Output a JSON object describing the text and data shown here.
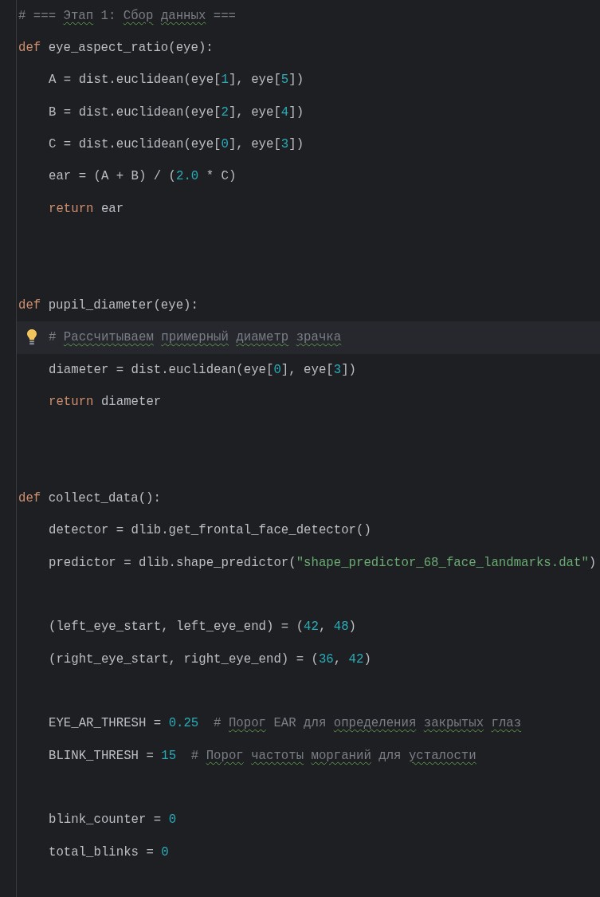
{
  "editor": {
    "lines": [
      {
        "kind": "code",
        "indented": false,
        "highlighted": false,
        "bulb": false,
        "tokens": [
          {
            "kind": "com",
            "text": "# === "
          },
          {
            "kind": "typo",
            "text": "Этап"
          },
          {
            "kind": "com",
            "text": " 1: "
          },
          {
            "kind": "typo",
            "text": "Сбор"
          },
          {
            "kind": "typo",
            "text": " данных"
          },
          {
            "kind": "com",
            "text": " ==="
          }
        ]
      },
      {
        "kind": "code",
        "indented": false,
        "highlighted": false,
        "bulb": false,
        "tokens": [
          {
            "kind": "kw",
            "text": "def"
          },
          {
            "kind": "id",
            "text": " eye_aspect_ratio(eye):"
          }
        ]
      },
      {
        "kind": "code",
        "indented": true,
        "highlighted": false,
        "bulb": false,
        "tokens": [
          {
            "kind": "id",
            "text": "A = dist.euclidean(eye["
          },
          {
            "kind": "num",
            "text": "1"
          },
          {
            "kind": "id",
            "text": "], eye["
          },
          {
            "kind": "num",
            "text": "5"
          },
          {
            "kind": "id",
            "text": "])"
          }
        ]
      },
      {
        "kind": "code",
        "indented": true,
        "highlighted": false,
        "bulb": false,
        "tokens": [
          {
            "kind": "id",
            "text": "B = dist.euclidean(eye["
          },
          {
            "kind": "num",
            "text": "2"
          },
          {
            "kind": "id",
            "text": "], eye["
          },
          {
            "kind": "num",
            "text": "4"
          },
          {
            "kind": "id",
            "text": "])"
          }
        ]
      },
      {
        "kind": "code",
        "indented": true,
        "highlighted": false,
        "bulb": false,
        "tokens": [
          {
            "kind": "id",
            "text": "C = dist.euclidean(eye["
          },
          {
            "kind": "num",
            "text": "0"
          },
          {
            "kind": "id",
            "text": "], eye["
          },
          {
            "kind": "num",
            "text": "3"
          },
          {
            "kind": "id",
            "text": "])"
          }
        ]
      },
      {
        "kind": "code",
        "indented": true,
        "highlighted": false,
        "bulb": false,
        "tokens": [
          {
            "kind": "id",
            "text": "ear = (A + B) / ("
          },
          {
            "kind": "num",
            "text": "2.0"
          },
          {
            "kind": "id",
            "text": " * C)"
          }
        ]
      },
      {
        "kind": "code",
        "indented": true,
        "highlighted": false,
        "bulb": false,
        "tokens": [
          {
            "kind": "kw",
            "text": "return"
          },
          {
            "kind": "id",
            "text": " ear"
          }
        ]
      },
      {
        "kind": "blank"
      },
      {
        "kind": "blank"
      },
      {
        "kind": "code",
        "indented": false,
        "highlighted": false,
        "bulb": false,
        "tokens": [
          {
            "kind": "kw",
            "text": "def"
          },
          {
            "kind": "id",
            "text": " pupil_diameter(eye):"
          }
        ]
      },
      {
        "kind": "code",
        "indented": true,
        "highlighted": true,
        "bulb": true,
        "tokens": [
          {
            "kind": "com",
            "text": "# "
          },
          {
            "kind": "typo",
            "text": "Рассчитываем"
          },
          {
            "kind": "typo",
            "text": " примерный"
          },
          {
            "kind": "typo",
            "text": " диаметр"
          },
          {
            "kind": "typo",
            "text": " зрачка"
          }
        ]
      },
      {
        "kind": "code",
        "indented": true,
        "highlighted": false,
        "bulb": false,
        "tokens": [
          {
            "kind": "id",
            "text": "diameter = dist.euclidean(eye["
          },
          {
            "kind": "num",
            "text": "0"
          },
          {
            "kind": "id",
            "text": "], eye["
          },
          {
            "kind": "num",
            "text": "3"
          },
          {
            "kind": "id",
            "text": "])"
          }
        ]
      },
      {
        "kind": "code",
        "indented": true,
        "highlighted": false,
        "bulb": false,
        "tokens": [
          {
            "kind": "kw",
            "text": "return"
          },
          {
            "kind": "id",
            "text": " diameter"
          }
        ]
      },
      {
        "kind": "blank"
      },
      {
        "kind": "blank"
      },
      {
        "kind": "code",
        "indented": false,
        "highlighted": false,
        "bulb": false,
        "tokens": [
          {
            "kind": "kw",
            "text": "def"
          },
          {
            "kind": "id",
            "text": " collect_data():"
          }
        ]
      },
      {
        "kind": "code",
        "indented": true,
        "highlighted": false,
        "bulb": false,
        "tokens": [
          {
            "kind": "id",
            "text": "detector = dlib.get_frontal_face_detector()"
          }
        ]
      },
      {
        "kind": "code",
        "indented": true,
        "highlighted": false,
        "bulb": false,
        "tokens": [
          {
            "kind": "id",
            "text": "predictor = dlib.shape_predictor("
          },
          {
            "kind": "str",
            "text": "\"shape_predictor_68_face_landmarks.dat\""
          },
          {
            "kind": "id",
            "text": ")"
          }
        ]
      },
      {
        "kind": "blank"
      },
      {
        "kind": "code",
        "indented": true,
        "highlighted": false,
        "bulb": false,
        "tokens": [
          {
            "kind": "id",
            "text": "(left_eye_start, left_eye_end) = ("
          },
          {
            "kind": "num",
            "text": "42"
          },
          {
            "kind": "id",
            "text": ", "
          },
          {
            "kind": "num",
            "text": "48"
          },
          {
            "kind": "id",
            "text": ")"
          }
        ]
      },
      {
        "kind": "code",
        "indented": true,
        "highlighted": false,
        "bulb": false,
        "tokens": [
          {
            "kind": "id",
            "text": "(right_eye_start, right_eye_end) = ("
          },
          {
            "kind": "num",
            "text": "36"
          },
          {
            "kind": "id",
            "text": ", "
          },
          {
            "kind": "num",
            "text": "42"
          },
          {
            "kind": "id",
            "text": ")"
          }
        ]
      },
      {
        "kind": "blank"
      },
      {
        "kind": "code",
        "indented": true,
        "highlighted": false,
        "bulb": false,
        "tokens": [
          {
            "kind": "id",
            "text": "EYE_AR_THRESH = "
          },
          {
            "kind": "num",
            "text": "0.25"
          },
          {
            "kind": "com",
            "text": "  # "
          },
          {
            "kind": "typo",
            "text": "Порог"
          },
          {
            "kind": "com",
            "text": " EAR для "
          },
          {
            "kind": "typo",
            "text": "определения"
          },
          {
            "kind": "typo",
            "text": " закрытых"
          },
          {
            "kind": "typo",
            "text": " глаз"
          }
        ]
      },
      {
        "kind": "code",
        "indented": true,
        "highlighted": false,
        "bulb": false,
        "tokens": [
          {
            "kind": "id",
            "text": "BLINK_THRESH = "
          },
          {
            "kind": "num",
            "text": "15"
          },
          {
            "kind": "com",
            "text": "  # "
          },
          {
            "kind": "typo",
            "text": "Порог"
          },
          {
            "kind": "typo",
            "text": " частоты"
          },
          {
            "kind": "typo",
            "text": " морганий"
          },
          {
            "kind": "com",
            "text": " для "
          },
          {
            "kind": "typo",
            "text": "усталости"
          }
        ]
      },
      {
        "kind": "blank"
      },
      {
        "kind": "code",
        "indented": true,
        "highlighted": false,
        "bulb": false,
        "tokens": [
          {
            "kind": "id",
            "text": "blink_counter = "
          },
          {
            "kind": "num",
            "text": "0"
          }
        ]
      },
      {
        "kind": "code",
        "indented": true,
        "highlighted": false,
        "bulb": false,
        "tokens": [
          {
            "kind": "id",
            "text": "total_blinks = "
          },
          {
            "kind": "num",
            "text": "0"
          }
        ]
      }
    ]
  }
}
